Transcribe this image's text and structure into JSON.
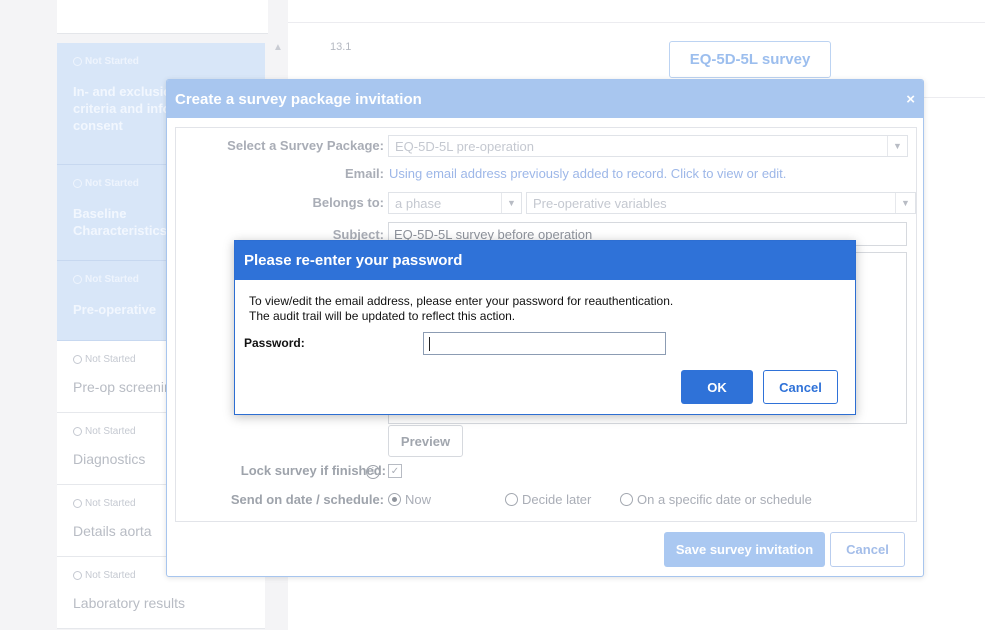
{
  "sidebar": {
    "items": [
      {
        "status": "Not Started",
        "title": "In- and exclusion\ncriteria and informed\nconsent",
        "active": true
      },
      {
        "status": "Not Started",
        "title": "Baseline\nCharacteristics",
        "active": true
      },
      {
        "status": "Not Started",
        "title": "Pre-operative",
        "active": true
      },
      {
        "status": "Not Started",
        "title": "Pre-op screening",
        "active": false
      },
      {
        "status": "Not Started",
        "title": "Diagnostics",
        "active": false
      },
      {
        "status": "Not Started",
        "title": "Details aorta",
        "active": false
      },
      {
        "status": "Not Started",
        "title": "Laboratory results",
        "active": false
      }
    ]
  },
  "main": {
    "step_number": "13.1",
    "survey_button": "EQ-5D-5L survey"
  },
  "survey_dialog": {
    "title": "Create a survey package invitation",
    "close": "×",
    "select_package_label": "Select a Survey Package:",
    "select_package_value": "EQ-5D-5L pre-operation",
    "email_label": "Email:",
    "email_link": "Using email address previously added to record. Click to view or edit.",
    "belongs_to_label": "Belongs to:",
    "belongs_to_phase": "a phase",
    "belongs_to_step": "Pre-operative variables",
    "subject_label": "Subject:",
    "subject_value": "EQ-5D-5L survey before operation",
    "preview_button": "Preview",
    "lock_label": "Lock survey if finished:",
    "send_label": "Send on date / schedule:",
    "send_options": [
      "Now",
      "Decide later",
      "On a specific date or schedule"
    ],
    "save_button": "Save survey invitation",
    "cancel_button": "Cancel"
  },
  "password_modal": {
    "title": "Please re-enter your password",
    "message_line1": "To view/edit the email address, please enter your password for reauthentication.",
    "message_line2": "The audit trail will be updated to reflect this action.",
    "password_label": "Password:",
    "password_value": "",
    "ok_button": "OK",
    "cancel_button": "Cancel"
  },
  "colors": {
    "accent": "#2f72d8",
    "accent_faded": "#a8c6ef"
  }
}
